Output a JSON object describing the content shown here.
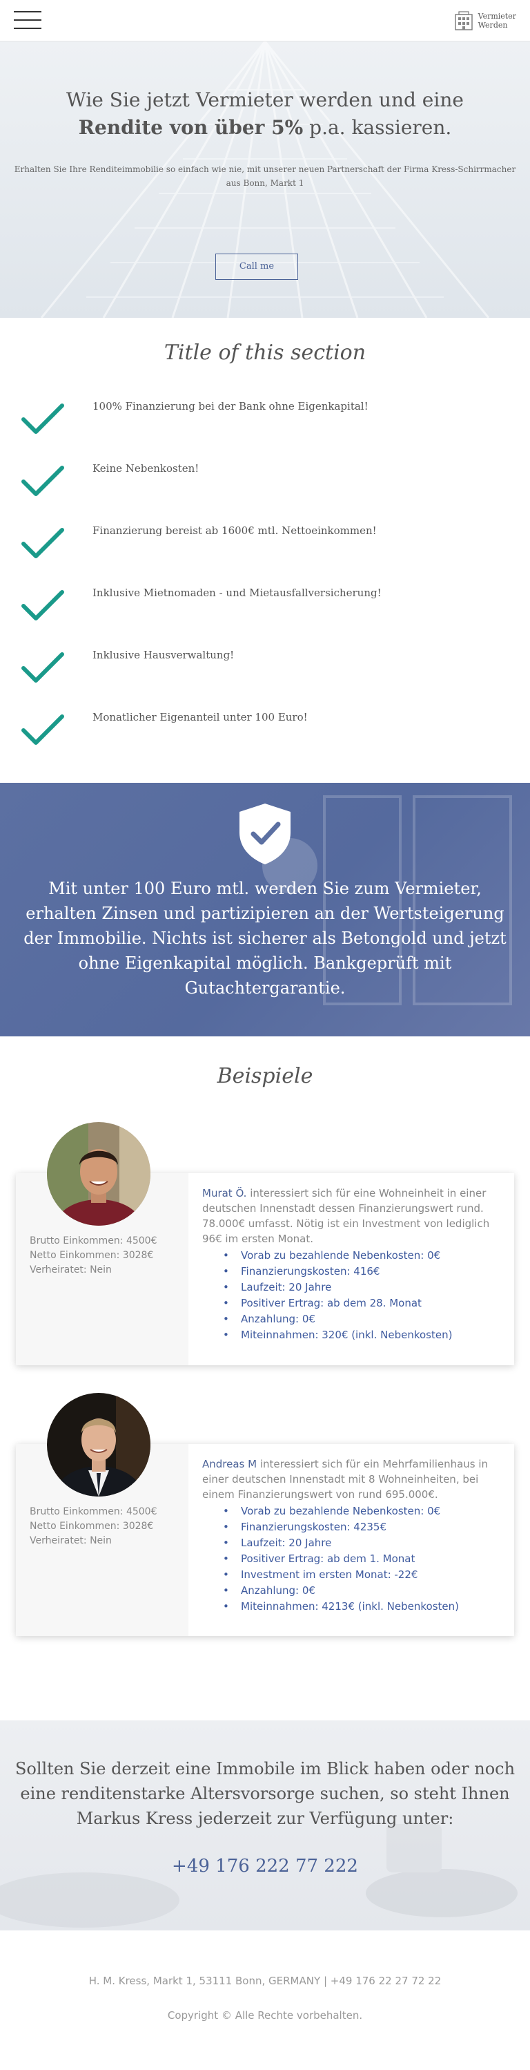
{
  "header": {
    "menu_icon": "hamburger-icon",
    "logo_icon": "building-icon",
    "logo_line1": "Vermieter",
    "logo_line2": "Werden"
  },
  "hero": {
    "title_line1": "Wie Sie jetzt Vermieter werden und eine",
    "title_bold": "Rendite von über 5%",
    "title_rest": " p.a. kassieren.",
    "subtitle": "Erhalten Sie Ihre Renditeimmobilie so einfach wie nie, mit unserer neuen Partnerschaft der Firma Kress-Schirrmacher aus Bonn, Markt 1",
    "button": "Call me"
  },
  "features": {
    "title": "Title of this section",
    "check_icon": "checkmark-icon",
    "check_color": "#1a9a8a",
    "items": [
      "100% Finanzierung bei der Bank ohne Eigenkapital!",
      "Keine Nebenkosten!",
      "Finanzierung bereist ab 1600€ mtl. Nettoeinkommen!",
      "Inklusive Mietnomaden - und Mietausfallversicherung!",
      "Inklusive Hausverwaltung!",
      "Monatlicher Eigenanteil unter 100 Euro!"
    ]
  },
  "band": {
    "icon": "shield-check-icon",
    "text": "Mit unter 100 Euro mtl. werden Sie zum Vermieter, erhalten Zinsen und partizipieren an der Wertsteigerung der Immobilie. Nichts ist sicherer als Betongold und jetzt ohne Eigenkapital möglich. Bankgeprüft mit Gutachtergarantie."
  },
  "examples": {
    "title": "Beispiele",
    "cards": [
      {
        "stats": [
          "Brutto Einkommen: 4500€",
          "Netto Einkommen: 3028€",
          "Verheiratet: Nein"
        ],
        "name": "Murat Ö.",
        "intro": " interessiert sich für eine Wohneinheit in einer deutschen Innenstadt dessen Finanzierungswert rund. 78.000€ umfasst. Nötig ist ein Investment von lediglich 96€ im ersten Monat.",
        "bullets": [
          "Vorab zu bezahlende Nebenkosten: 0€",
          "Finanzierungskosten: 416€",
          "Laufzeit: 20 Jahre",
          "Positiver Ertrag: ab dem 28. Monat",
          "Anzahlung: 0€",
          "Miteinnahmen: 320€ (inkl. Nebenkosten)"
        ]
      },
      {
        "stats": [
          "Brutto Einkommen: 4500€",
          "Netto Einkommen: 3028€",
          "Verheiratet: Nein"
        ],
        "name": "Andreas M",
        "intro": " interessiert sich für ein Mehrfamilienhaus in einer deutschen Innenstadt mit 8 Wohneinheiten, bei einem Finanzierungswert von rund 695.000€.",
        "bullets": [
          "Vorab zu bezahlende Nebenkosten: 0€",
          "Finanzierungskosten: 4235€",
          "Laufzeit: 20 Jahre",
          "Positiver Ertrag: ab dem 1. Monat",
          "Investment im ersten Monat: -22€",
          "Anzahlung: 0€",
          "Miteinnahmen: 4213€ (inkl. Nebenkosten)"
        ]
      }
    ]
  },
  "contact": {
    "text": "Sollten Sie derzeit eine Immobile im Blick haben oder noch eine renditenstarke Altersvorsorge suchen, so steht Ihnen Markus Kress jederzeit zur Verfügung unter:",
    "phone": "+49 176 222 77 222"
  },
  "footer": {
    "address": "H. M. Kress, Markt 1, 53111 Bonn, GERMANY",
    "separator": "|",
    "phone": "+49 176 22 27 72 22",
    "copyright": "Copyright © Alle Rechte vorbehalten."
  },
  "colors": {
    "accent": "#4b6297",
    "band": "#5c70a2",
    "bullet_blue": "#3e5a9e"
  }
}
